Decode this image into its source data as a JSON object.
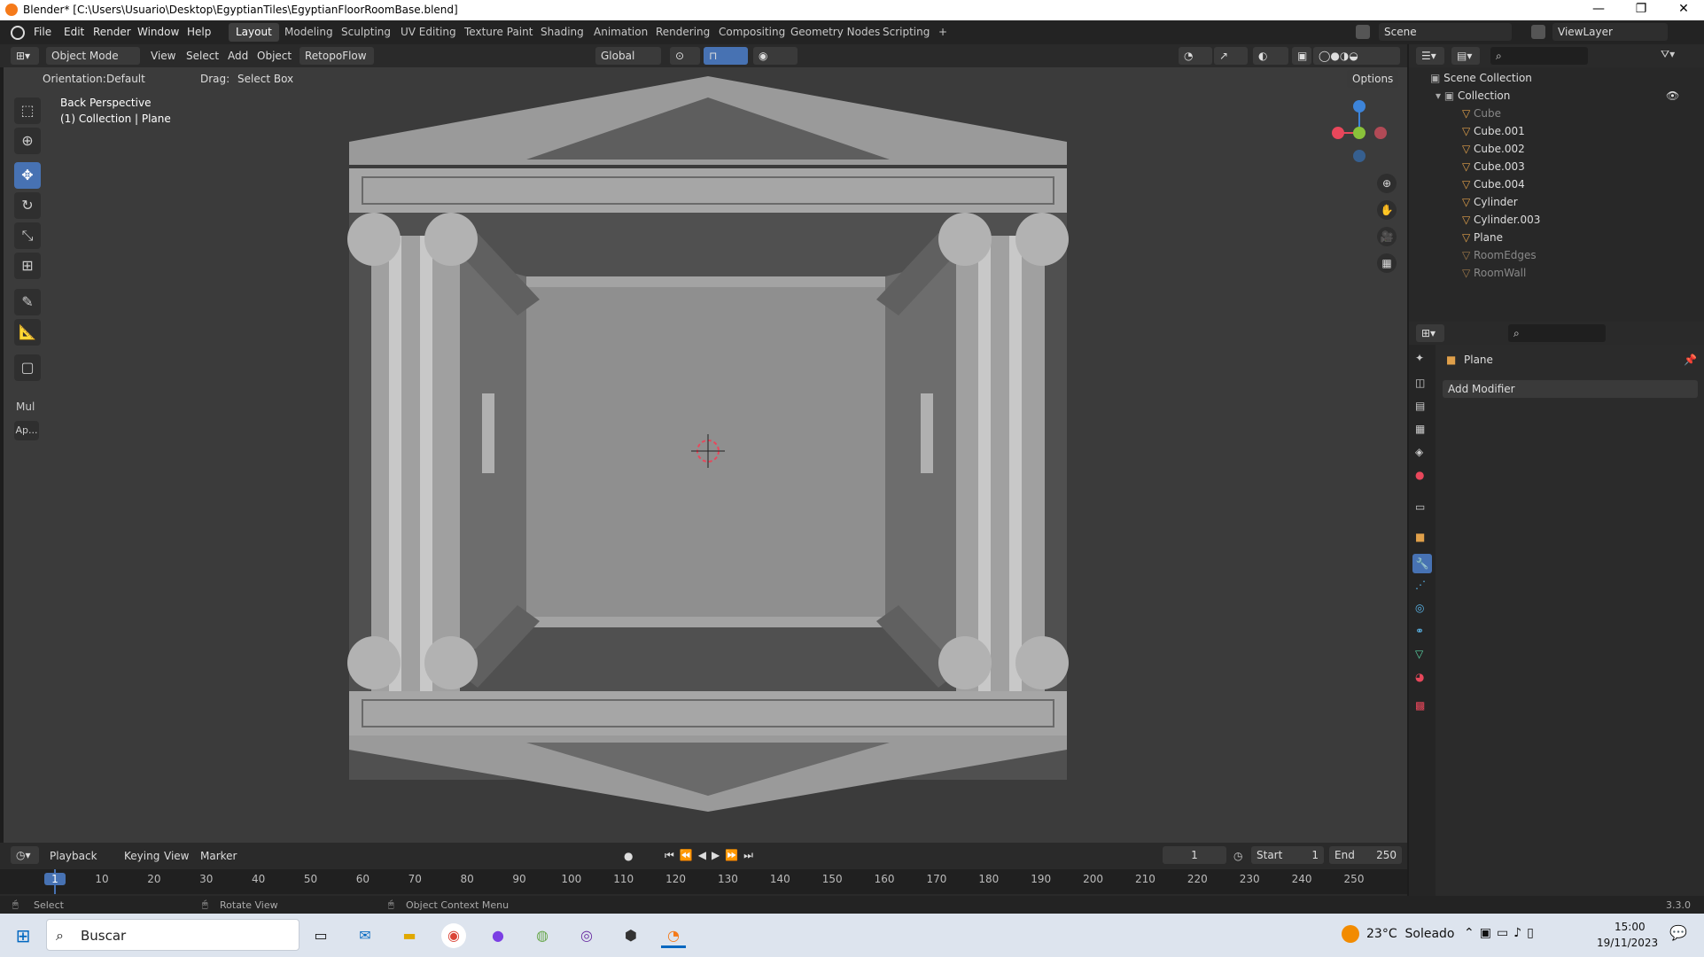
{
  "window": {
    "title": "Blender* [C:\\Users\\Usuario\\Desktop\\EgyptianTiles\\EgyptianFloorRoomBase.blend]",
    "minimize": "—",
    "restore": "❐",
    "close": "✕"
  },
  "menus": [
    "File",
    "Edit",
    "Render",
    "Window",
    "Help"
  ],
  "workspaces": [
    "Layout",
    "Modeling",
    "Sculpting",
    "UV Editing",
    "Texture Paint",
    "Shading",
    "Animation",
    "Rendering",
    "Compositing",
    "Geometry Nodes",
    "Scripting",
    "+"
  ],
  "scene": {
    "name": "Scene",
    "view_layer": "ViewLayer"
  },
  "viewport_header": {
    "mode": "Object Mode",
    "view": "View",
    "select": "Select",
    "add": "Add",
    "object": "Object",
    "addon": "RetopoFlow",
    "transform": "Global",
    "options": "Options"
  },
  "sub_header": {
    "orientation_label": "Orientation:",
    "orientation_value": "Default",
    "drag_label": "Drag:",
    "drag_value": "Select Box"
  },
  "viewport_info": {
    "line1": "Back Perspective",
    "line2": "(1) Collection | Plane"
  },
  "toolbar": {
    "extra1": "Mul",
    "extra2": "Ap..."
  },
  "outliner": {
    "root": "Scene Collection",
    "collection": "Collection",
    "items": [
      {
        "name": "Cube",
        "dim": true
      },
      {
        "name": "Cube.001",
        "dim": false
      },
      {
        "name": "Cube.002",
        "dim": false
      },
      {
        "name": "Cube.003",
        "dim": false
      },
      {
        "name": "Cube.004",
        "dim": false
      },
      {
        "name": "Cylinder",
        "dim": false
      },
      {
        "name": "Cylinder.003",
        "dim": false
      },
      {
        "name": "Plane",
        "dim": false
      },
      {
        "name": "RoomEdges",
        "dim": true
      },
      {
        "name": "RoomWall",
        "dim": true
      }
    ]
  },
  "properties": {
    "object_name": "Plane",
    "add_modifier": "Add Modifier"
  },
  "timeline": {
    "menus": [
      "Playback",
      "Keying",
      "View",
      "Marker"
    ],
    "current_frame": "1",
    "start_label": "Start",
    "start": "1",
    "end_label": "End",
    "end": "250",
    "ruler": [
      "1",
      "10",
      "20",
      "30",
      "40",
      "50",
      "60",
      "70",
      "80",
      "90",
      "100",
      "110",
      "120",
      "130",
      "140",
      "150",
      "160",
      "170",
      "180",
      "190",
      "200",
      "210",
      "220",
      "230",
      "240",
      "250"
    ]
  },
  "statusbar": {
    "select": "Select",
    "rotate": "Rotate View",
    "context": "Object Context Menu",
    "version": "3.3.0"
  },
  "taskbar": {
    "search": "Buscar",
    "weather": "23°C  Soleado",
    "time": "15:00",
    "date": "19/11/2023"
  },
  "colors": {
    "accent": "#4772b3",
    "viewport_bg": "#3b3b3b",
    "gizmo_x": "#e8475b",
    "gizmo_y": "#8ac23a",
    "gizmo_z": "#3d84d9",
    "object_icon": "#e0a04a",
    "mesh_icon": "#5ad3a5"
  }
}
